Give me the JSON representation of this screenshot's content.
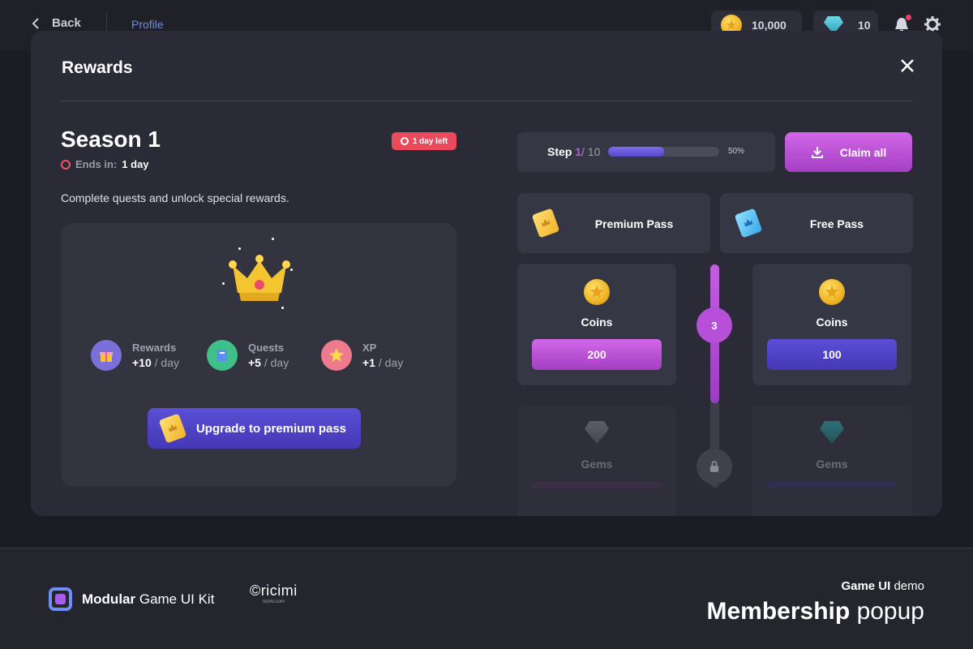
{
  "topbar": {
    "back_label": "Back",
    "profile_label": "Profile",
    "coins": "10,000",
    "gems": "10"
  },
  "modal": {
    "title": "Rewards",
    "season": "Season 1",
    "ends_label": "Ends in:",
    "ends_value": "1 day",
    "badge": "1 day left",
    "description": "Complete quests and unlock special rewards.",
    "stats": [
      {
        "label": "Rewards",
        "value": "+10",
        "unit": "/ day"
      },
      {
        "label": "Quests",
        "value": "+5",
        "unit": "/ day"
      },
      {
        "label": "XP",
        "value": "+1",
        "unit": "/ day"
      }
    ],
    "upgrade_label": "Upgrade to premium pass"
  },
  "progress": {
    "step_label": "Step",
    "step_current": "1",
    "step_total": "/ 10",
    "percent_text": "50%",
    "fill_fraction": 0.5
  },
  "claim_label": "Claim all",
  "passes": {
    "premium": "Premium Pass",
    "free": "Free Pass"
  },
  "track": {
    "current_step": "3",
    "fill_fraction": 0.62
  },
  "rewards": {
    "premium_coins": {
      "name": "Coins",
      "value": "200"
    },
    "free_coins": {
      "name": "Coins",
      "value": "100"
    },
    "premium_gems": {
      "name": "Gems"
    },
    "free_gems": {
      "name": "Gems"
    }
  },
  "footer": {
    "kit_bold": "Modular",
    "kit_rest": "Game UI Kit",
    "ricimi_word": "©ricimi",
    "ricimi_url": "ricimi.com",
    "demo_bold": "Game UI",
    "demo_rest": "demo",
    "title_bold": "Membership",
    "title_rest": "popup"
  },
  "colors": {
    "accent_pink": "#b74fd9",
    "accent_indigo": "#4f44c9",
    "badge_red": "#ea4a5b"
  }
}
